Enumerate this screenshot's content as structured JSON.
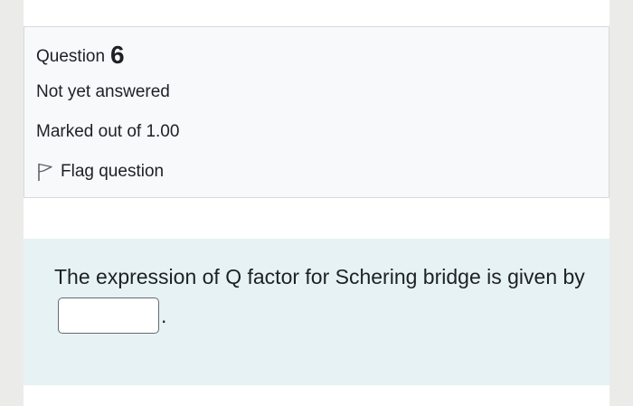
{
  "info": {
    "question_label": "Question",
    "question_number": "6",
    "state": "Not yet answered",
    "grade": "Marked out of 1.00",
    "flag_label": "Flag question",
    "flag_icon": "flag-icon"
  },
  "question": {
    "text_before": "The expression of Q factor for Schering bridge  is given by",
    "text_after": ".",
    "answer_value": ""
  }
}
